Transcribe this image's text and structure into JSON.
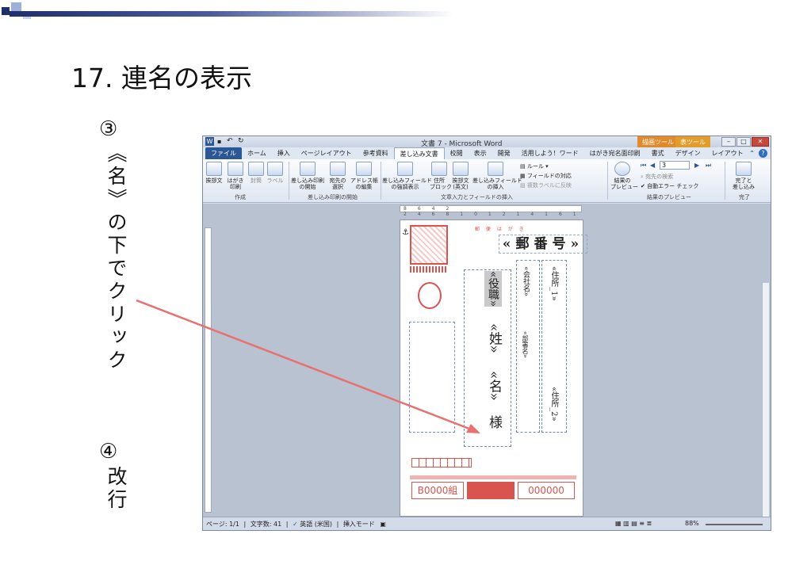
{
  "slide": {
    "title": "17. 連名の表示",
    "step3_number": "③",
    "step3_text": "《名》の下でクリック",
    "step4_number": "④",
    "step4_text": "改行"
  },
  "window": {
    "title": "文書 7 - Microsoft Word",
    "context_tab_drawing": "描画ツール",
    "context_tab_table": "表ツール",
    "tabs": [
      "ファイル",
      "ホーム",
      "挿入",
      "ページレイアウト",
      "参考資料",
      "差し込み文書",
      "校閲",
      "表示",
      "開発",
      "活用しよう！ワード",
      "はがき宛名面印刷",
      "書式",
      "デザイン",
      "レイアウト"
    ],
    "active_tab": "差し込み文書"
  },
  "ribbon": {
    "buttons": {
      "greeting": "挨拶文",
      "postcard_print": "はがき\n印刷",
      "envelope": "封筒",
      "label": "ラベル",
      "start_merge": "差し込み印刷\nの開始",
      "select_recipients": "宛先の\n選択",
      "edit_address_list": "アドレス帳\nの編集",
      "highlight_fields": "差し込みフィールド\nの強調表示",
      "address_block": "住所\nブロック",
      "greeting_line": "挨拶文\n(英文)",
      "insert_field": "差し込みフィールド\nの挿入",
      "rules": "ルール",
      "match_fields": "フィールドの対応",
      "update_labels": "複数ラベルに反映",
      "preview_results": "結果の\nプレビュー",
      "record_number": "3",
      "find_recipient": "宛先の検索",
      "auto_check_errors": "自動エラー チェック",
      "finish_merge": "完了と\n差し込み"
    },
    "groups": {
      "create": "作成",
      "start_merge": "差し込み印刷の開始",
      "write_insert": "文章入力とフィールドの挿入",
      "preview": "結果のプレビュー",
      "finish": "完了"
    }
  },
  "postcard": {
    "postcard_label": "郵 便 は が き",
    "zip_field": "«郵番号»",
    "title_field": "«役職»",
    "surname_field": "«姓»",
    "name_field": "«名»",
    "honorific": "様",
    "company_field": "«会社名»",
    "address1_field": "«住所_1»",
    "department_field": "«部署名»",
    "address2_field": "«住所_2»",
    "lottery_number": "B0000組",
    "lottery_number_2": "000000"
  },
  "status": {
    "page": "ページ: 1/1",
    "words": "文字数: 41",
    "language": "英語 (米国)",
    "mode": "挿入モード",
    "zoom": "88%"
  },
  "colors": {
    "arrow": "#e8706f",
    "postcard_red": "#d9534f",
    "file_tab": "#2b5797",
    "drawing_tab": "#e08a2b",
    "table_tab": "#e39b2a"
  }
}
